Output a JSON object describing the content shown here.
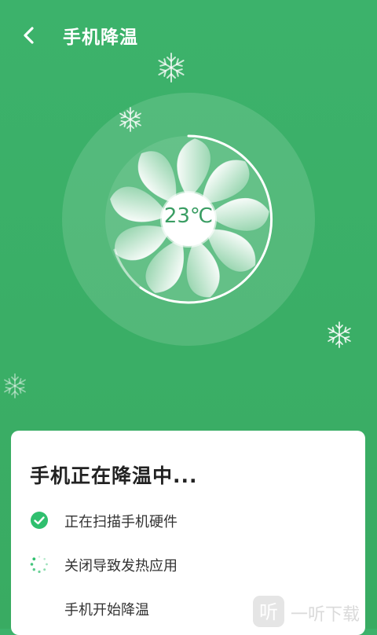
{
  "header": {
    "title": "手机降温"
  },
  "fan": {
    "temperature": "23℃"
  },
  "card": {
    "title": "手机正在降温中...",
    "steps": [
      {
        "label": "正在扫描手机硬件",
        "status": "done"
      },
      {
        "label": "关闭导致发热应用",
        "status": "loading"
      },
      {
        "label": "手机开始降温",
        "status": "pending"
      }
    ]
  },
  "watermark": {
    "text": "一听下载"
  },
  "colors": {
    "background": "#3cb26b",
    "accent": "#2fbf6e",
    "card": "#ffffff"
  }
}
